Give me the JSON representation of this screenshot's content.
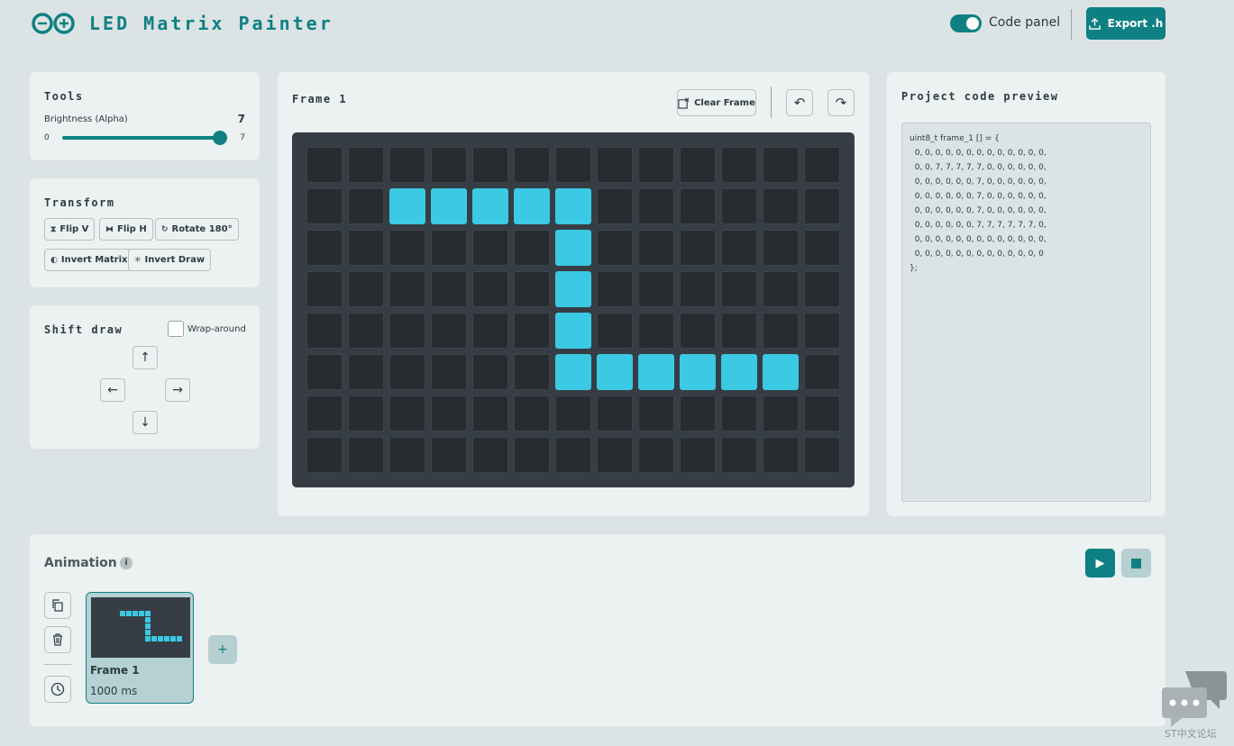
{
  "header": {
    "title": "LED Matrix Painter",
    "code_panel_label": "Code panel",
    "code_panel_on": true,
    "export_label": "Export .h"
  },
  "tools": {
    "title": "Tools",
    "brightness_label": "Brightness (Alpha)",
    "brightness_value": "7",
    "min": "0",
    "max": "7",
    "level_fraction": 1.0
  },
  "transform": {
    "title": "Transform",
    "flip_v": "Flip V",
    "flip_h": "Flip H",
    "rotate": "Rotate 180°",
    "invert_matrix": "Invert Matrix",
    "invert_draw": "Invert Draw"
  },
  "shift": {
    "title": "Shift draw",
    "wrap_label": "Wrap-around",
    "wrap_checked": false
  },
  "canvas": {
    "frame_title": "Frame 1",
    "clear_label": "Clear Frame",
    "on_color": "#3bc9e3",
    "off_color": "#262c30",
    "rows": [
      [
        0,
        0,
        0,
        0,
        0,
        0,
        0,
        0,
        0,
        0,
        0,
        0,
        0
      ],
      [
        0,
        0,
        7,
        7,
        7,
        7,
        7,
        0,
        0,
        0,
        0,
        0,
        0
      ],
      [
        0,
        0,
        0,
        0,
        0,
        0,
        7,
        0,
        0,
        0,
        0,
        0,
        0
      ],
      [
        0,
        0,
        0,
        0,
        0,
        0,
        7,
        0,
        0,
        0,
        0,
        0,
        0
      ],
      [
        0,
        0,
        0,
        0,
        0,
        0,
        7,
        0,
        0,
        0,
        0,
        0,
        0
      ],
      [
        0,
        0,
        0,
        0,
        0,
        0,
        7,
        7,
        7,
        7,
        7,
        7,
        0
      ],
      [
        0,
        0,
        0,
        0,
        0,
        0,
        0,
        0,
        0,
        0,
        0,
        0,
        0
      ],
      [
        0,
        0,
        0,
        0,
        0,
        0,
        0,
        0,
        0,
        0,
        0,
        0,
        0
      ]
    ]
  },
  "code": {
    "title": "Project code preview",
    "text": "uint8_t frame_1 [] = {\n  0, 0, 0, 0, 0, 0, 0, 0, 0, 0, 0, 0, 0,\n  0, 0, 7, 7, 7, 7, 7, 0, 0, 0, 0, 0, 0,\n  0, 0, 0, 0, 0, 0, 7, 0, 0, 0, 0, 0, 0,\n  0, 0, 0, 0, 0, 0, 7, 0, 0, 0, 0, 0, 0,\n  0, 0, 0, 0, 0, 0, 7, 0, 0, 0, 0, 0, 0,\n  0, 0, 0, 0, 0, 0, 7, 7, 7, 7, 7, 7, 0,\n  0, 0, 0, 0, 0, 0, 0, 0, 0, 0, 0, 0, 0,\n  0, 0, 0, 0, 0, 0, 0, 0, 0, 0, 0, 0, 0\n};"
  },
  "animation": {
    "title": "Animation",
    "info": "i",
    "add_label": "+",
    "frames": [
      {
        "name": "Frame 1",
        "duration": "1000 ms"
      }
    ]
  },
  "watermark": {
    "text": "ST中文论坛"
  },
  "colors": {
    "accent": "#0e8083",
    "led_on": "#3bc9e3",
    "panel": "#ecf1f1",
    "background": "#dce3e4"
  }
}
